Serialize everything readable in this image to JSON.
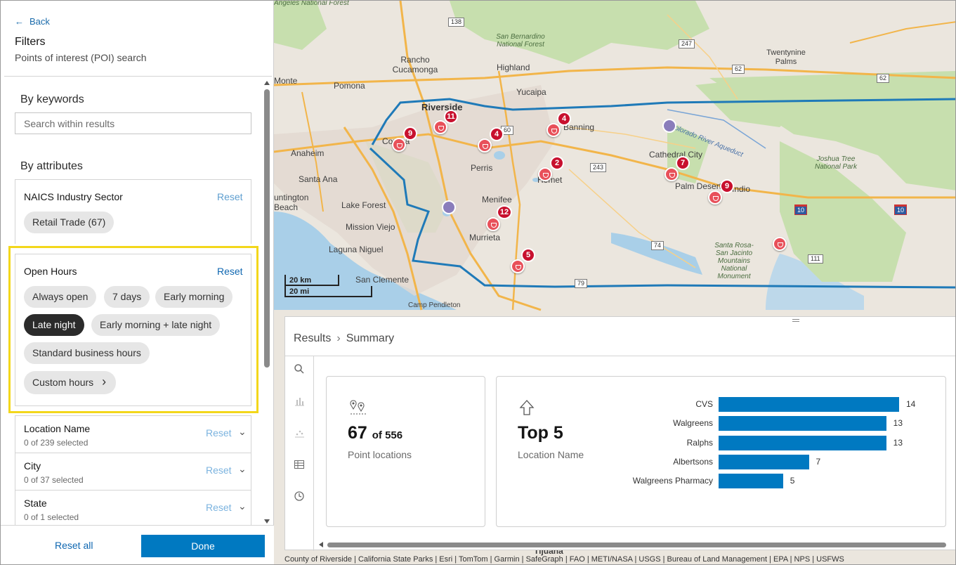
{
  "nav": {
    "back_icon": "←",
    "back_label": "Back"
  },
  "panel": {
    "title": "Filters",
    "subtitle": "Points of interest (POI) search"
  },
  "keywords": {
    "heading": "By keywords",
    "placeholder": "Search within results"
  },
  "attributes": {
    "heading": "By attributes",
    "naics": {
      "title": "NAICS Industry Sector",
      "reset": "Reset",
      "chip": "Retail Trade (67)"
    },
    "open_hours": {
      "title": "Open Hours",
      "reset": "Reset",
      "chips": [
        "Always open",
        "7 days",
        "Early morning",
        "Late night",
        "Early morning + late night",
        "Standard business hours"
      ],
      "selected": "Late night",
      "custom": "Custom hours",
      "custom_icon": "›"
    },
    "accordions": [
      {
        "title": "Location Name",
        "sub": "0 of 239 selected",
        "reset": "Reset",
        "icon": "⌄"
      },
      {
        "title": "City",
        "sub": "0 of 37 selected",
        "reset": "Reset",
        "icon": "⌄"
      },
      {
        "title": "State",
        "sub": "0 of 1 selected",
        "reset": "Reset",
        "icon": "⌄"
      }
    ]
  },
  "footer": {
    "reset_all": "Reset all",
    "done": "Done"
  },
  "map": {
    "places": [
      "Rancho Cucamonga",
      "Highland",
      "Yucaipa",
      "Pomona",
      "Riverside",
      "Corona",
      "Anaheim",
      "Santa Ana",
      "Lake Forest",
      "Mission Viejo",
      "Laguna Niguel",
      "San Clemente",
      "Camp Pendleton",
      "Perris",
      "Menifee",
      "Murrieta",
      "Hemet",
      "Banning",
      "Cathedral City",
      "Palm Desert",
      "Indio",
      "Twentynine Palms",
      "Monte",
      "untington Beach",
      "Tijuana",
      "Colorado River Aqueduct"
    ],
    "parks": [
      "Angeles National Forest",
      "San Bernardino National Forest",
      "Joshua Tree National Park",
      "Santa Rosa-San Jacinto Mountains National Monument"
    ],
    "shields": [
      "138",
      "247",
      "62",
      "62",
      "60",
      "243",
      "74",
      "79",
      "111",
      "10",
      "10"
    ],
    "clusters": [
      "9",
      "11",
      "4",
      "4",
      "2",
      "7",
      "9",
      "12",
      "5"
    ],
    "scale_km": "20 km",
    "scale_mi": "20 mi",
    "attribution": "County of Riverside | California State Parks | Esri | TomTom | Garmin | SafeGraph | FAO | METI/NASA | USGS | Bureau of Land Management | EPA | NPS | USFWS"
  },
  "results": {
    "crumb_root": "Results",
    "crumb_sep": "›",
    "crumb_current": "Summary",
    "rail_icons": [
      "search-icon",
      "bar-chart-icon",
      "scatter-chart-icon",
      "table-icon",
      "clock-icon"
    ],
    "count_card": {
      "value": "67",
      "of": "of 556",
      "caption": "Point locations"
    },
    "top_card": {
      "title": "Top 5",
      "caption": "Location Name"
    }
  },
  "chart_data": {
    "type": "bar",
    "orientation": "horizontal",
    "categories": [
      "CVS",
      "Walgreens",
      "Ralphs",
      "Albertsons",
      "Walgreens Pharmacy"
    ],
    "values": [
      14,
      13,
      13,
      7,
      5
    ],
    "color": "#0079c1",
    "title": "",
    "xlabel": "",
    "ylabel": ""
  }
}
